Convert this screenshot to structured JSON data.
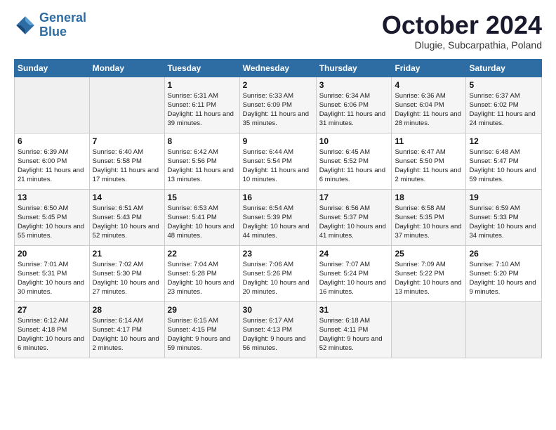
{
  "header": {
    "logo_line1": "General",
    "logo_line2": "Blue",
    "month": "October 2024",
    "location": "Dlugie, Subcarpathia, Poland"
  },
  "weekdays": [
    "Sunday",
    "Monday",
    "Tuesday",
    "Wednesday",
    "Thursday",
    "Friday",
    "Saturday"
  ],
  "weeks": [
    [
      {
        "day": "",
        "info": ""
      },
      {
        "day": "",
        "info": ""
      },
      {
        "day": "1",
        "info": "Sunrise: 6:31 AM\nSunset: 6:11 PM\nDaylight: 11 hours and 39 minutes."
      },
      {
        "day": "2",
        "info": "Sunrise: 6:33 AM\nSunset: 6:09 PM\nDaylight: 11 hours and 35 minutes."
      },
      {
        "day": "3",
        "info": "Sunrise: 6:34 AM\nSunset: 6:06 PM\nDaylight: 11 hours and 31 minutes."
      },
      {
        "day": "4",
        "info": "Sunrise: 6:36 AM\nSunset: 6:04 PM\nDaylight: 11 hours and 28 minutes."
      },
      {
        "day": "5",
        "info": "Sunrise: 6:37 AM\nSunset: 6:02 PM\nDaylight: 11 hours and 24 minutes."
      }
    ],
    [
      {
        "day": "6",
        "info": "Sunrise: 6:39 AM\nSunset: 6:00 PM\nDaylight: 11 hours and 21 minutes."
      },
      {
        "day": "7",
        "info": "Sunrise: 6:40 AM\nSunset: 5:58 PM\nDaylight: 11 hours and 17 minutes."
      },
      {
        "day": "8",
        "info": "Sunrise: 6:42 AM\nSunset: 5:56 PM\nDaylight: 11 hours and 13 minutes."
      },
      {
        "day": "9",
        "info": "Sunrise: 6:44 AM\nSunset: 5:54 PM\nDaylight: 11 hours and 10 minutes."
      },
      {
        "day": "10",
        "info": "Sunrise: 6:45 AM\nSunset: 5:52 PM\nDaylight: 11 hours and 6 minutes."
      },
      {
        "day": "11",
        "info": "Sunrise: 6:47 AM\nSunset: 5:50 PM\nDaylight: 11 hours and 2 minutes."
      },
      {
        "day": "12",
        "info": "Sunrise: 6:48 AM\nSunset: 5:47 PM\nDaylight: 10 hours and 59 minutes."
      }
    ],
    [
      {
        "day": "13",
        "info": "Sunrise: 6:50 AM\nSunset: 5:45 PM\nDaylight: 10 hours and 55 minutes."
      },
      {
        "day": "14",
        "info": "Sunrise: 6:51 AM\nSunset: 5:43 PM\nDaylight: 10 hours and 52 minutes."
      },
      {
        "day": "15",
        "info": "Sunrise: 6:53 AM\nSunset: 5:41 PM\nDaylight: 10 hours and 48 minutes."
      },
      {
        "day": "16",
        "info": "Sunrise: 6:54 AM\nSunset: 5:39 PM\nDaylight: 10 hours and 44 minutes."
      },
      {
        "day": "17",
        "info": "Sunrise: 6:56 AM\nSunset: 5:37 PM\nDaylight: 10 hours and 41 minutes."
      },
      {
        "day": "18",
        "info": "Sunrise: 6:58 AM\nSunset: 5:35 PM\nDaylight: 10 hours and 37 minutes."
      },
      {
        "day": "19",
        "info": "Sunrise: 6:59 AM\nSunset: 5:33 PM\nDaylight: 10 hours and 34 minutes."
      }
    ],
    [
      {
        "day": "20",
        "info": "Sunrise: 7:01 AM\nSunset: 5:31 PM\nDaylight: 10 hours and 30 minutes."
      },
      {
        "day": "21",
        "info": "Sunrise: 7:02 AM\nSunset: 5:30 PM\nDaylight: 10 hours and 27 minutes."
      },
      {
        "day": "22",
        "info": "Sunrise: 7:04 AM\nSunset: 5:28 PM\nDaylight: 10 hours and 23 minutes."
      },
      {
        "day": "23",
        "info": "Sunrise: 7:06 AM\nSunset: 5:26 PM\nDaylight: 10 hours and 20 minutes."
      },
      {
        "day": "24",
        "info": "Sunrise: 7:07 AM\nSunset: 5:24 PM\nDaylight: 10 hours and 16 minutes."
      },
      {
        "day": "25",
        "info": "Sunrise: 7:09 AM\nSunset: 5:22 PM\nDaylight: 10 hours and 13 minutes."
      },
      {
        "day": "26",
        "info": "Sunrise: 7:10 AM\nSunset: 5:20 PM\nDaylight: 10 hours and 9 minutes."
      }
    ],
    [
      {
        "day": "27",
        "info": "Sunrise: 6:12 AM\nSunset: 4:18 PM\nDaylight: 10 hours and 6 minutes."
      },
      {
        "day": "28",
        "info": "Sunrise: 6:14 AM\nSunset: 4:17 PM\nDaylight: 10 hours and 2 minutes."
      },
      {
        "day": "29",
        "info": "Sunrise: 6:15 AM\nSunset: 4:15 PM\nDaylight: 9 hours and 59 minutes."
      },
      {
        "day": "30",
        "info": "Sunrise: 6:17 AM\nSunset: 4:13 PM\nDaylight: 9 hours and 56 minutes."
      },
      {
        "day": "31",
        "info": "Sunrise: 6:18 AM\nSunset: 4:11 PM\nDaylight: 9 hours and 52 minutes."
      },
      {
        "day": "",
        "info": ""
      },
      {
        "day": "",
        "info": ""
      }
    ]
  ]
}
